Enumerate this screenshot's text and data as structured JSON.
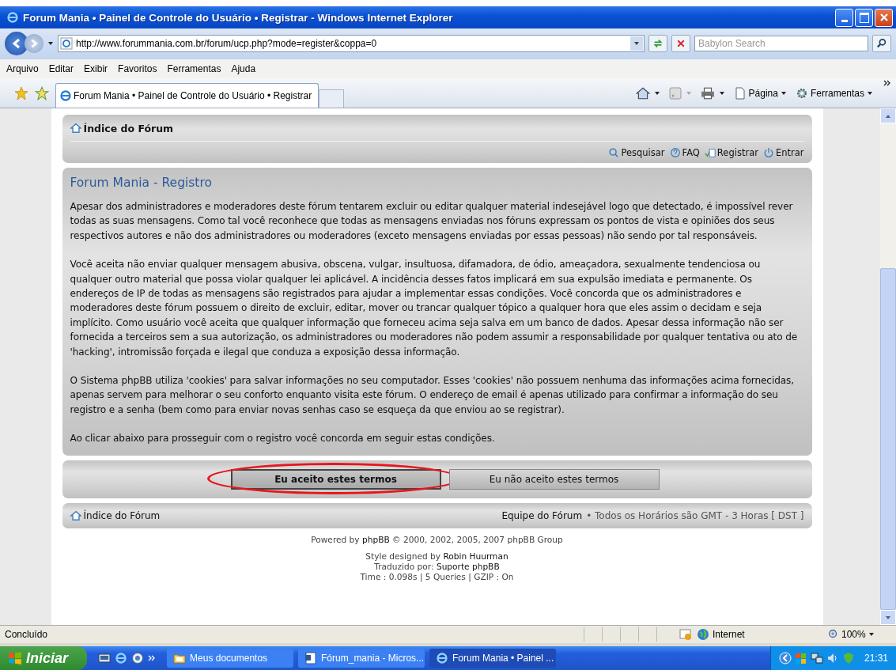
{
  "window": {
    "title": "Forum Mania • Painel de Controle do Usuário • Registrar - Windows Internet Explorer"
  },
  "address_bar": {
    "url": "http://www.forummania.com.br/forum/ucp.php?mode=register&coppa=0"
  },
  "search": {
    "placeholder": "Babylon Search"
  },
  "menu": [
    "Arquivo",
    "Editar",
    "Exibir",
    "Favoritos",
    "Ferramentas",
    "Ajuda"
  ],
  "tabs": [
    {
      "label": "Forum Mania • Painel de Controle do Usuário • Registrar",
      "selected": true
    }
  ],
  "command_bar": [
    {
      "label": "Página",
      "kind": "page"
    },
    {
      "label": "Ferramentas",
      "kind": "tools"
    }
  ],
  "page": {
    "nav_top": {
      "home_link": "Índice do Fórum",
      "links": [
        {
          "label": "Pesquisar",
          "kind": "search"
        },
        {
          "label": "FAQ",
          "kind": "faq"
        },
        {
          "label": "Registrar",
          "kind": "register"
        },
        {
          "label": "Entrar",
          "kind": "login"
        }
      ]
    },
    "heading": "Forum Mania - Registro",
    "paragraphs": [
      "Apesar dos administradores e moderadores deste fórum tentarem excluir ou editar qualquer material indesejável logo que detectado, é impossível rever todas as suas mensagens. Como tal você reconhece que todas as mensagens enviadas nos fóruns expressam os pontos de vista e opiniões dos seus respectivos autores e não dos administradores ou moderadores (exceto mensagens enviadas por essas pessoas) não sendo por tal responsáveis.",
      "Você aceita não enviar qualquer mensagem abusiva, obscena, vulgar, insultuosa, difamadora, de ódio, ameaçadora, sexualmente tendenciosa ou qualquer outro material que possa violar qualquer lei aplicável. A incidência desses fatos implicará em sua expulsão imediata e permanente. Os endereços de IP de todas as mensagens são registrados para ajudar a implementar essas condições. Você concorda que os administradores e moderadores deste fórum possuem o direito de excluir, editar, mover ou trancar qualquer tópico a qualquer hora que eles assim o decidam e seja implícito. Como usuário você aceita que qualquer informação que forneceu acima seja salva em um banco de dados. Apesar dessa informação não ser fornecida a terceiros sem a sua autorização, os administradores ou moderadores não podem assumir a responsabilidade por qualquer tentativa ou ato de 'hacking', intromissão forçada e ilegal que conduza a exposição dessa informação.",
      "O Sistema phpBB utiliza 'cookies' para salvar informações no seu computador. Esses 'cookies' não possuem nenhuma das informações acima fornecidas, apenas servem para melhorar o seu conforto enquanto visita este fórum. O endereço de email é apenas utilizado para confirmar a informação do seu registro e a senha (bem como para enviar novas senhas caso se esqueça da que enviou ao se registrar).",
      "Ao clicar abaixo para prosseguir com o registro você concorda em seguir estas condições."
    ],
    "buttons": [
      {
        "label": "Eu aceito estes termos",
        "selected": true,
        "circled": true
      },
      {
        "label": "Eu não aceito estes termos",
        "selected": false,
        "circled": false
      }
    ],
    "nav_bottom": {
      "home_link": "Índice do Fórum",
      "team_link": "Equipe do Fórum",
      "timezone": "• Todos os Horários são GMT - 3 Horas [ DST ]"
    },
    "footer": [
      "Powered by **phpBB** © 2000, 2002, 2005, 2007 phpBB Group",
      "Style designed by **Robin Huurman**",
      "Traduzido por: **Suporte phpBB**",
      "Time : 0.098s | 5 Queries | GZIP : On"
    ]
  },
  "status_bar": {
    "status": "Concluído",
    "zone": "Internet",
    "zoom": "100%"
  },
  "taskbar": {
    "start": "Iniciar",
    "tasks": [
      {
        "label": "Meus documentos",
        "kind": "folder",
        "selected": false
      },
      {
        "label": "Fórum_mania - Micros...",
        "kind": "document",
        "selected": false
      },
      {
        "label": "Forum Mania • Painel ...",
        "kind": "browser",
        "selected": true
      }
    ],
    "clock": "21:31"
  }
}
